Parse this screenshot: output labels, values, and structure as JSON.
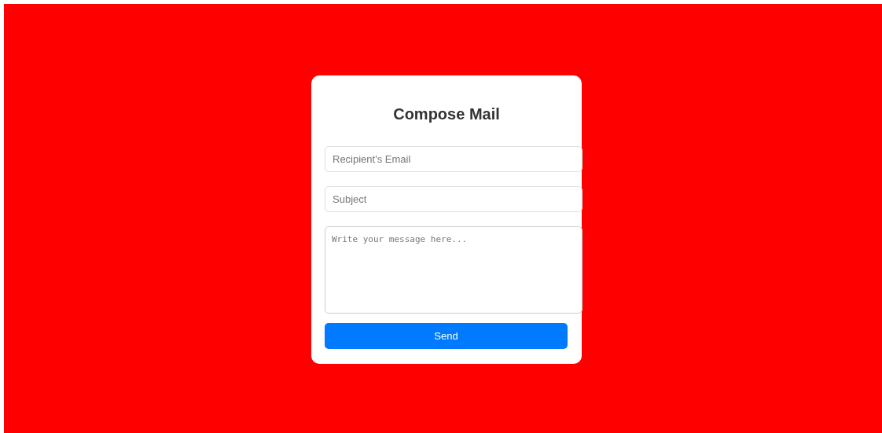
{
  "form": {
    "title": "Compose Mail",
    "fields": [
      {
        "kind": "input",
        "placeholder": "Recipient's Email"
      },
      {
        "kind": "input",
        "placeholder": "Subject"
      },
      {
        "kind": "textarea",
        "placeholder": "Write your message here..."
      }
    ],
    "button": "Send"
  }
}
